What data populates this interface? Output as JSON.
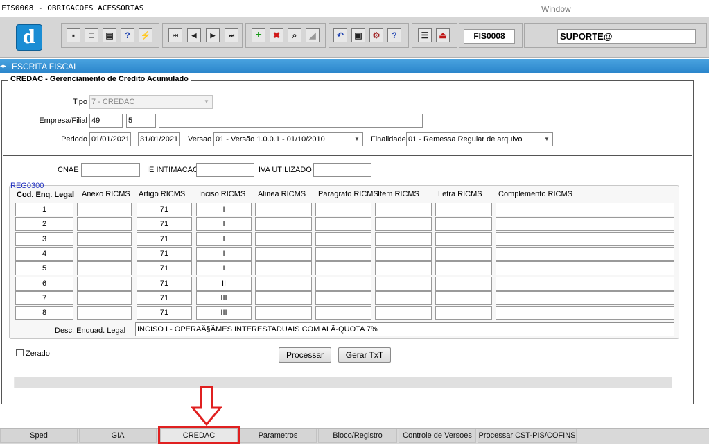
{
  "window": {
    "title": "FIS0008 - OBRIGACOES ACESSORIAS",
    "menu": "Window"
  },
  "toolbar": {
    "logo_letter": "d",
    "form_id": "FIS0008",
    "user": "SUPORTE@",
    "groups": [
      {
        "buttons": [
          "save-icon",
          "window-icon",
          "print-icon",
          "help-query-icon",
          "lightning-query-icon"
        ],
        "glyphs": [
          "▪",
          "□",
          "▤",
          "?",
          "⚡"
        ]
      },
      {
        "buttons": [
          "first-record-icon",
          "previous-record-icon",
          "next-record-icon",
          "last-record-icon"
        ],
        "glyphs": [
          "⏮",
          "◀",
          "▶",
          "⏭"
        ]
      },
      {
        "buttons": [
          "insert-record-icon",
          "delete-record-icon",
          "query-icon",
          "clear-icon"
        ],
        "glyphs": [
          "+",
          "✖",
          "⌕",
          "◢"
        ]
      },
      {
        "buttons": [
          "undo-icon",
          "copy-icon",
          "tools-icon",
          "help-icon"
        ],
        "glyphs": [
          "↶",
          "▣",
          "⚙",
          "?"
        ]
      },
      {
        "buttons": [
          "menu-icon",
          "exit-icon"
        ],
        "glyphs": [
          "☰",
          "⏏"
        ]
      }
    ]
  },
  "section": {
    "title": "ESCRITA FISCAL"
  },
  "frame": {
    "title": "CREDAC  - Gerenciamento de Credito Acumulado"
  },
  "form": {
    "tipo_label": "Tipo",
    "tipo_value": "7 - CREDAC",
    "empresa_label": "Empresa/Filial",
    "empresa_value": "49",
    "filial_value": "5",
    "filial_desc": "",
    "periodo_label": "Periodo",
    "periodo_start": "01/01/2021",
    "periodo_end": "31/01/2021",
    "versao_label": "Versao",
    "versao_value": "01 - Versão 1.0.0.1  - 01/10/2010",
    "finalidade_label": "Finalidade",
    "finalidade_value": "01 - Remessa Regular de arquivo",
    "cnae_label": "CNAE",
    "cnae_value": "",
    "ie_label": "IE INTIMACAO",
    "ie_value": "",
    "iva_label": "IVA UTILIZADO",
    "iva_value": ""
  },
  "reg0300": {
    "block_title": "REG0300",
    "columns": [
      "Cod. Enq. Legal",
      "Anexo RICMS",
      "Artigo RICMS",
      "Inciso RICMS",
      "Alinea RICMS",
      "Paragrafo RICMS",
      "Item RICMS",
      "Letra RICMS",
      "Complemento RICMS"
    ],
    "rows": [
      {
        "cod": "1",
        "anexo": "",
        "artigo": "71",
        "inciso": "I",
        "alinea": "",
        "paragrafo": "",
        "item": "",
        "letra": "",
        "complemento": ""
      },
      {
        "cod": "2",
        "anexo": "",
        "artigo": "71",
        "inciso": "I",
        "alinea": "",
        "paragrafo": "",
        "item": "",
        "letra": "",
        "complemento": ""
      },
      {
        "cod": "3",
        "anexo": "",
        "artigo": "71",
        "inciso": "I",
        "alinea": "",
        "paragrafo": "",
        "item": "",
        "letra": "",
        "complemento": ""
      },
      {
        "cod": "4",
        "anexo": "",
        "artigo": "71",
        "inciso": "I",
        "alinea": "",
        "paragrafo": "",
        "item": "",
        "letra": "",
        "complemento": ""
      },
      {
        "cod": "5",
        "anexo": "",
        "artigo": "71",
        "inciso": "I",
        "alinea": "",
        "paragrafo": "",
        "item": "",
        "letra": "",
        "complemento": ""
      },
      {
        "cod": "6",
        "anexo": "",
        "artigo": "71",
        "inciso": "II",
        "alinea": "",
        "paragrafo": "",
        "item": "",
        "letra": "",
        "complemento": ""
      },
      {
        "cod": "7",
        "anexo": "",
        "artigo": "71",
        "inciso": "III",
        "alinea": "",
        "paragrafo": "",
        "item": "",
        "letra": "",
        "complemento": ""
      },
      {
        "cod": "8",
        "anexo": "",
        "artigo": "71",
        "inciso": "III",
        "alinea": "",
        "paragrafo": "",
        "item": "",
        "letra": "",
        "complemento": ""
      }
    ],
    "desc_label": "Desc. Enquad. Legal",
    "desc_value": "INCISO I - OPERAÃ§ÃMES INTERESTADUAIS COM ALÃ-QUOTA 7%"
  },
  "zerado_label": "Zerado",
  "buttons": {
    "processar": "Processar",
    "gerar_txt": "Gerar TxT"
  },
  "tabs": [
    "Sped",
    "GIA",
    "CREDAC",
    "Parametros",
    "Bloco/Registro",
    "Controle de Versoes",
    "Processar CST-PIS/COFINS"
  ],
  "active_tab": "CREDAC",
  "colors": {
    "section_bar": "#2b86cc",
    "highlight": "#e02020",
    "block_title": "#2030c0"
  }
}
